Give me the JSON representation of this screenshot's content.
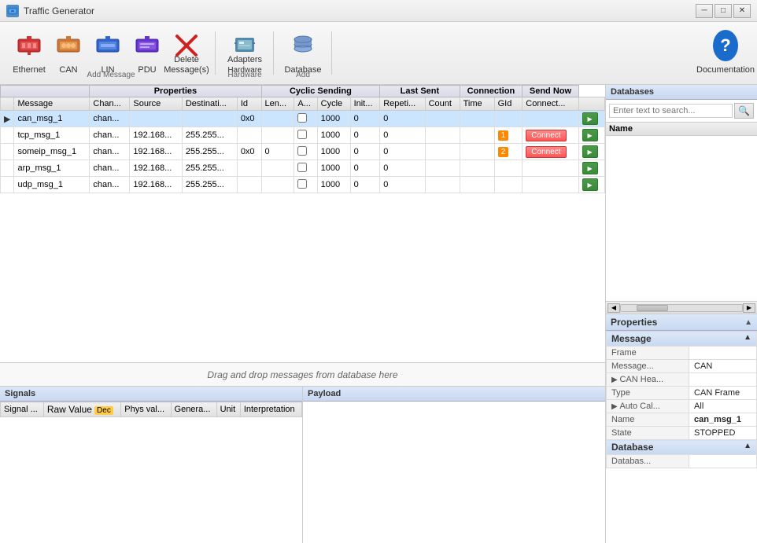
{
  "app": {
    "title": "Traffic Generator",
    "title_icon": "TG"
  },
  "titlebar": {
    "minimize_label": "─",
    "maximize_label": "□",
    "close_label": "✕"
  },
  "toolbar": {
    "ethernet_label": "Ethernet",
    "can_label": "CAN",
    "lin_label": "LIN",
    "pdu_label": "PDU",
    "delete_label": "Delete\nMessage(s)",
    "delete_label_line1": "Delete",
    "delete_label_line2": "Message(s)",
    "adapters_label": "Adapters",
    "hardware_label": "Hardware",
    "database_label": "Database",
    "documentation_label": "Documentation",
    "group_add": "Add Message",
    "group_hardware": "Hardware",
    "group_db_add": "Add"
  },
  "table": {
    "section_properties": "Properties",
    "section_cyclic": "Cyclic Sending",
    "section_lastsent": "Last Sent",
    "section_connection": "Connection",
    "section_sendnow": "Send Now",
    "col_message": "Message",
    "col_channel": "Chan...",
    "col_source": "Source",
    "col_destination": "Destinati...",
    "col_id": "Id",
    "col_length": "Len...",
    "col_a": "A...",
    "col_cycle": "Cycle",
    "col_init": "Init...",
    "col_repeti": "Repeti...",
    "col_count": "Count",
    "col_time": "Time",
    "col_gid": "GId",
    "col_connect": "Connect...",
    "rows": [
      {
        "name": "can_msg_1",
        "channel": "chan...",
        "source": "",
        "destination": "",
        "id": "0x0",
        "length": "",
        "a": "",
        "cycle": "1000",
        "init": "0",
        "repeti": "0",
        "count": "",
        "time": "",
        "gid": "",
        "connect": "",
        "selected": true,
        "arrow": true
      },
      {
        "name": "tcp_msg_1",
        "channel": "chan...",
        "source": "192.168...",
        "destination": "255.255...",
        "id": "",
        "length": "",
        "a": "",
        "cycle": "1000",
        "init": "0",
        "repeti": "0",
        "count": "",
        "time": "",
        "gid": "1",
        "connect": "Connect",
        "selected": false,
        "arrow": false
      },
      {
        "name": "someip_msg_1",
        "channel": "chan...",
        "source": "192.168...",
        "destination": "255.255...",
        "id": "0x0",
        "length": "0",
        "a": "",
        "cycle": "1000",
        "init": "0",
        "repeti": "0",
        "count": "",
        "time": "",
        "gid": "2",
        "connect": "Connect",
        "selected": false,
        "arrow": false
      },
      {
        "name": "arp_msg_1",
        "channel": "chan...",
        "source": "192.168...",
        "destination": "255.255...",
        "id": "",
        "length": "",
        "a": "",
        "cycle": "1000",
        "init": "0",
        "repeti": "0",
        "count": "",
        "time": "",
        "gid": "",
        "connect": "",
        "selected": false,
        "arrow": false
      },
      {
        "name": "udp_msg_1",
        "channel": "chan...",
        "source": "192.168...",
        "destination": "255.255...",
        "id": "",
        "length": "",
        "a": "",
        "cycle": "1000",
        "init": "0",
        "repeti": "0",
        "count": "",
        "time": "",
        "gid": "",
        "connect": "",
        "selected": false,
        "arrow": false
      }
    ]
  },
  "drop_area": {
    "text": "Drag and drop messages from database here"
  },
  "signals": {
    "title": "Signals",
    "col_signal": "Signal ...",
    "col_rawvalue": "Raw Value",
    "col_dec": "Dec",
    "col_physval": "Phys val...",
    "col_genera": "Genera...",
    "col_unit": "Unit",
    "col_interpretation": "Interpretation"
  },
  "payload": {
    "title": "Payload"
  },
  "databases": {
    "title": "Databases",
    "search_placeholder": "Enter text to search...",
    "search_icon": "🔍",
    "col_name": "Name"
  },
  "properties": {
    "title": "Properties",
    "group_message": "Message",
    "rows": [
      {
        "label": "Frame",
        "value": ""
      },
      {
        "label": "Message...",
        "value": "CAN"
      },
      {
        "label": "CAN Hea...",
        "value": "",
        "expandable": true
      },
      {
        "label": "Type",
        "value": "CAN Frame"
      },
      {
        "label": "Auto Cal...",
        "value": "All",
        "expandable": true
      },
      {
        "label": "Name",
        "value": "can_msg_1",
        "bold": true
      },
      {
        "label": "State",
        "value": "STOPPED"
      }
    ],
    "group_database": "Database",
    "db_rows": [
      {
        "label": "Databas...",
        "value": ""
      }
    ]
  }
}
